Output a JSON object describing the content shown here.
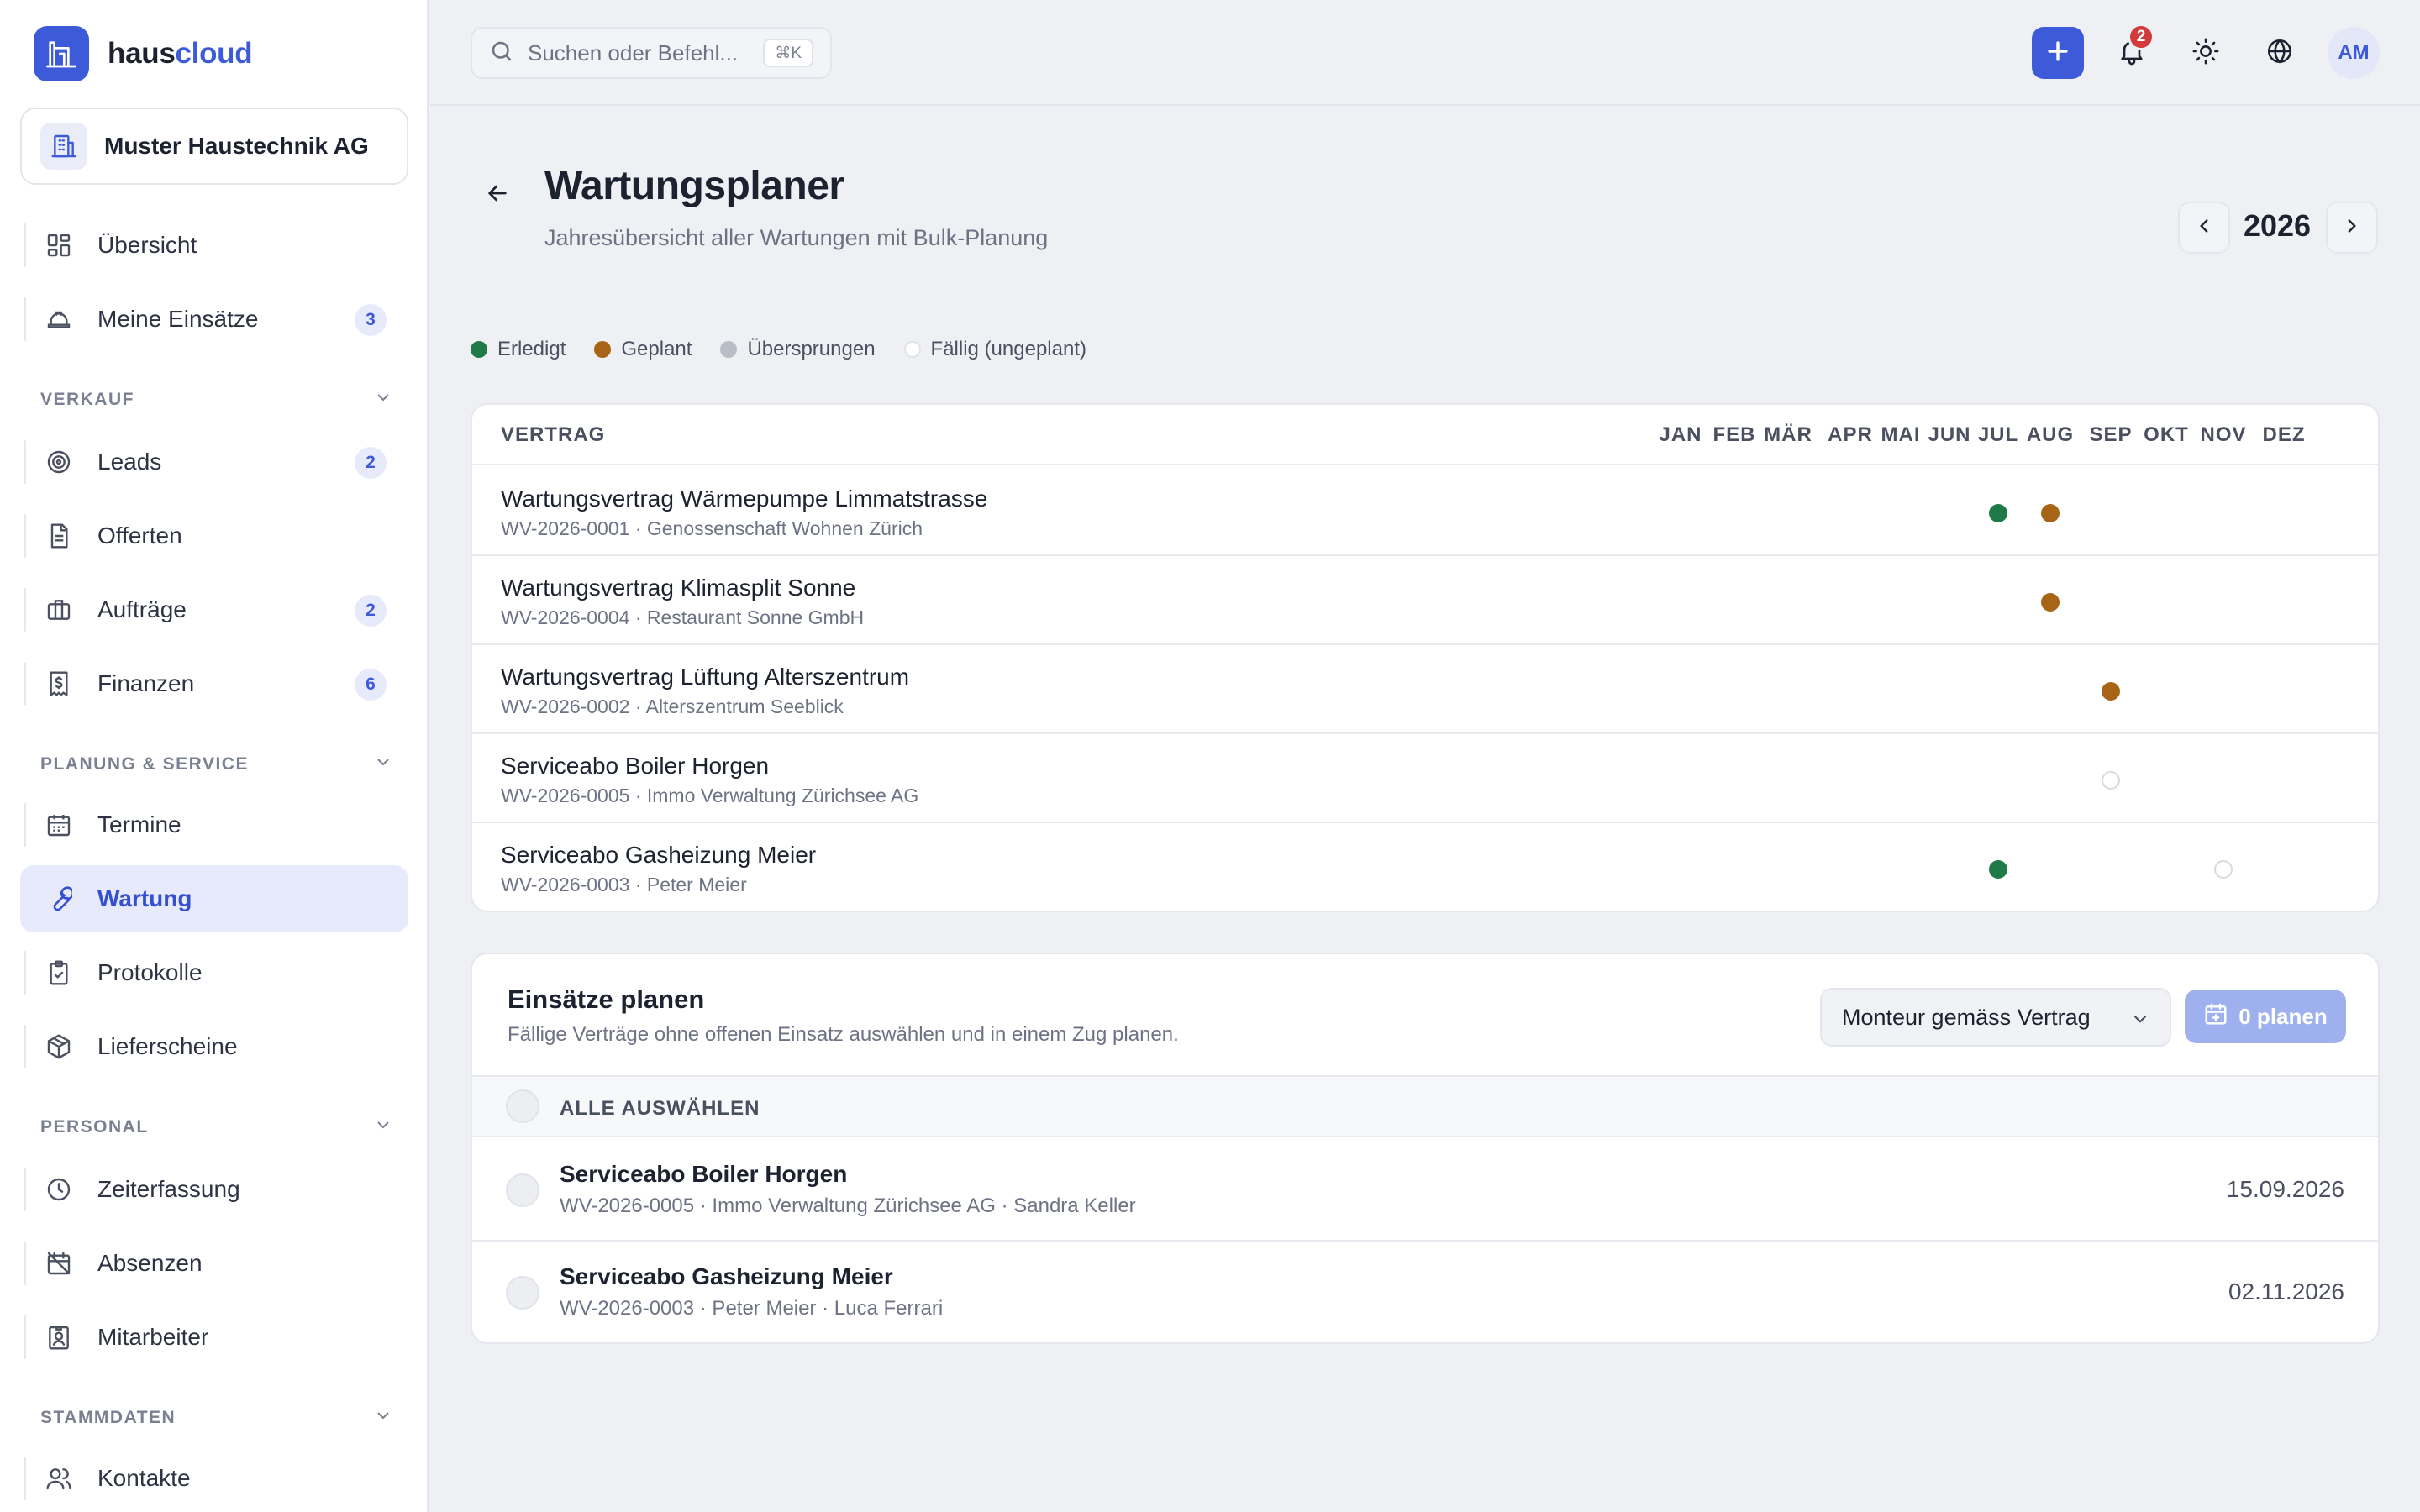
{
  "brand": {
    "name_a": "haus",
    "name_b": "cloud"
  },
  "company": {
    "name": "Muster Haustechnik AG"
  },
  "nav": {
    "uebersicht": "Übersicht",
    "meine_einsaetze": {
      "label": "Meine Einsätze",
      "badge": "3"
    },
    "section_verkauf": "VERKAUF",
    "leads": {
      "label": "Leads",
      "badge": "2"
    },
    "offerten": "Offerten",
    "auftraege": {
      "label": "Aufträge",
      "badge": "2"
    },
    "finanzen": {
      "label": "Finanzen",
      "badge": "6"
    },
    "section_planung": "PLANUNG & SERVICE",
    "termine": "Termine",
    "wartung": "Wartung",
    "protokolle": "Protokolle",
    "lieferscheine": "Lieferscheine",
    "section_personal": "PERSONAL",
    "zeiterfassung": "Zeiterfassung",
    "absenzen": "Absenzen",
    "mitarbeiter": "Mitarbeiter",
    "section_stammdaten": "STAMMDATEN",
    "kontakte": "Kontakte"
  },
  "topbar": {
    "search_placeholder": "Suchen oder Befehl...",
    "search_shortcut": "⌘K",
    "notification_count": "2",
    "avatar_initials": "AM"
  },
  "page": {
    "title": "Wartungsplaner",
    "subtitle": "Jahresübersicht aller Wartungen mit Bulk-Planung",
    "year": "2026"
  },
  "legend": [
    {
      "label": "Erledigt",
      "status": "done"
    },
    {
      "label": "Geplant",
      "status": "planned"
    },
    {
      "label": "Übersprungen",
      "status": "skipped"
    },
    {
      "label": "Fällig (ungeplant)",
      "status": "due"
    }
  ],
  "colors": {
    "accent": "#3d5bd9",
    "done": "#1e7a47",
    "planned": "#a86416",
    "skipped": "#b9bdc6",
    "due": "#ffffff"
  },
  "grid": {
    "col_contract": "VERTRAG",
    "months": [
      "JAN",
      "FEB",
      "MÄR",
      "APR",
      "MAI",
      "JUN",
      "JUL",
      "AUG",
      "SEP",
      "OKT",
      "NOV",
      "DEZ"
    ],
    "rows": [
      {
        "title": "Wartungsvertrag Wärmepumpe Limmatstrasse",
        "subtitle": "WV-2026-0001 · Genossenschaft Wohnen Zürich",
        "marks": [
          {
            "month": 7,
            "status": "done"
          },
          {
            "month": 8,
            "status": "planned"
          }
        ]
      },
      {
        "title": "Wartungsvertrag Klimasplit Sonne",
        "subtitle": "WV-2026-0004 · Restaurant Sonne GmbH",
        "marks": [
          {
            "month": 8,
            "status": "planned"
          }
        ]
      },
      {
        "title": "Wartungsvertrag Lüftung Alterszentrum",
        "subtitle": "WV-2026-0002 · Alterszentrum Seeblick",
        "marks": [
          {
            "month": 9,
            "status": "planned"
          }
        ]
      },
      {
        "title": "Serviceabo Boiler Horgen",
        "subtitle": "WV-2026-0005 · Immo Verwaltung Zürichsee AG",
        "marks": [
          {
            "month": 9,
            "status": "due"
          }
        ]
      },
      {
        "title": "Serviceabo Gasheizung Meier",
        "subtitle": "WV-2026-0003 · Peter Meier",
        "marks": [
          {
            "month": 7,
            "status": "done"
          },
          {
            "month": 11,
            "status": "due"
          }
        ]
      }
    ]
  },
  "plan": {
    "title": "Einsätze planen",
    "subtitle": "Fällige Verträge ohne offenen Einsatz auswählen und in einem Zug planen.",
    "select_value": "Monteur gemäss Vertrag",
    "button_label": "0 planen",
    "select_all": "ALLE AUSWÄHLEN",
    "rows": [
      {
        "title": "Serviceabo Boiler Horgen",
        "subtitle": "WV-2026-0005 · Immo Verwaltung Zürichsee AG · Sandra Keller",
        "date": "15.09.2026"
      },
      {
        "title": "Serviceabo Gasheizung Meier",
        "subtitle": "WV-2026-0003 · Peter Meier · Luca Ferrari",
        "date": "02.11.2026"
      }
    ]
  }
}
